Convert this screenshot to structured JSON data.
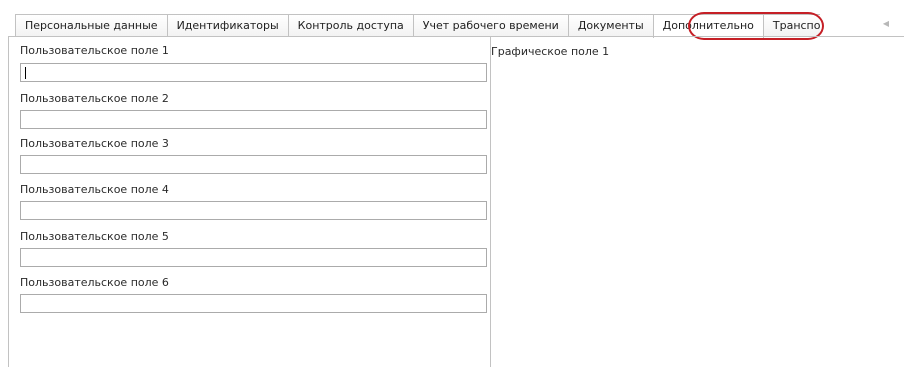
{
  "tabs": [
    {
      "label": "Персональные данные"
    },
    {
      "label": "Идентификаторы"
    },
    {
      "label": "Контроль доступа"
    },
    {
      "label": "Учет рабочего времени"
    },
    {
      "label": "Документы"
    },
    {
      "label": "Дополнительно"
    },
    {
      "label": "Транспо"
    }
  ],
  "active_tab": "Дополнительно",
  "tab_scroll_left_icon": "◀",
  "fields": [
    {
      "label": "Пользовательское поле 1",
      "value": ""
    },
    {
      "label": "Пользовательское поле 2",
      "value": ""
    },
    {
      "label": "Пользовательское поле 3",
      "value": ""
    },
    {
      "label": "Пользовательское поле 4",
      "value": ""
    },
    {
      "label": "Пользовательское поле 5",
      "value": ""
    },
    {
      "label": "Пользовательское поле 6",
      "value": ""
    }
  ],
  "graphic_field": {
    "label": "Графическое поле 1"
  },
  "colors": {
    "highlight_ring": "#c51f26",
    "border": "#c2c2c2"
  }
}
